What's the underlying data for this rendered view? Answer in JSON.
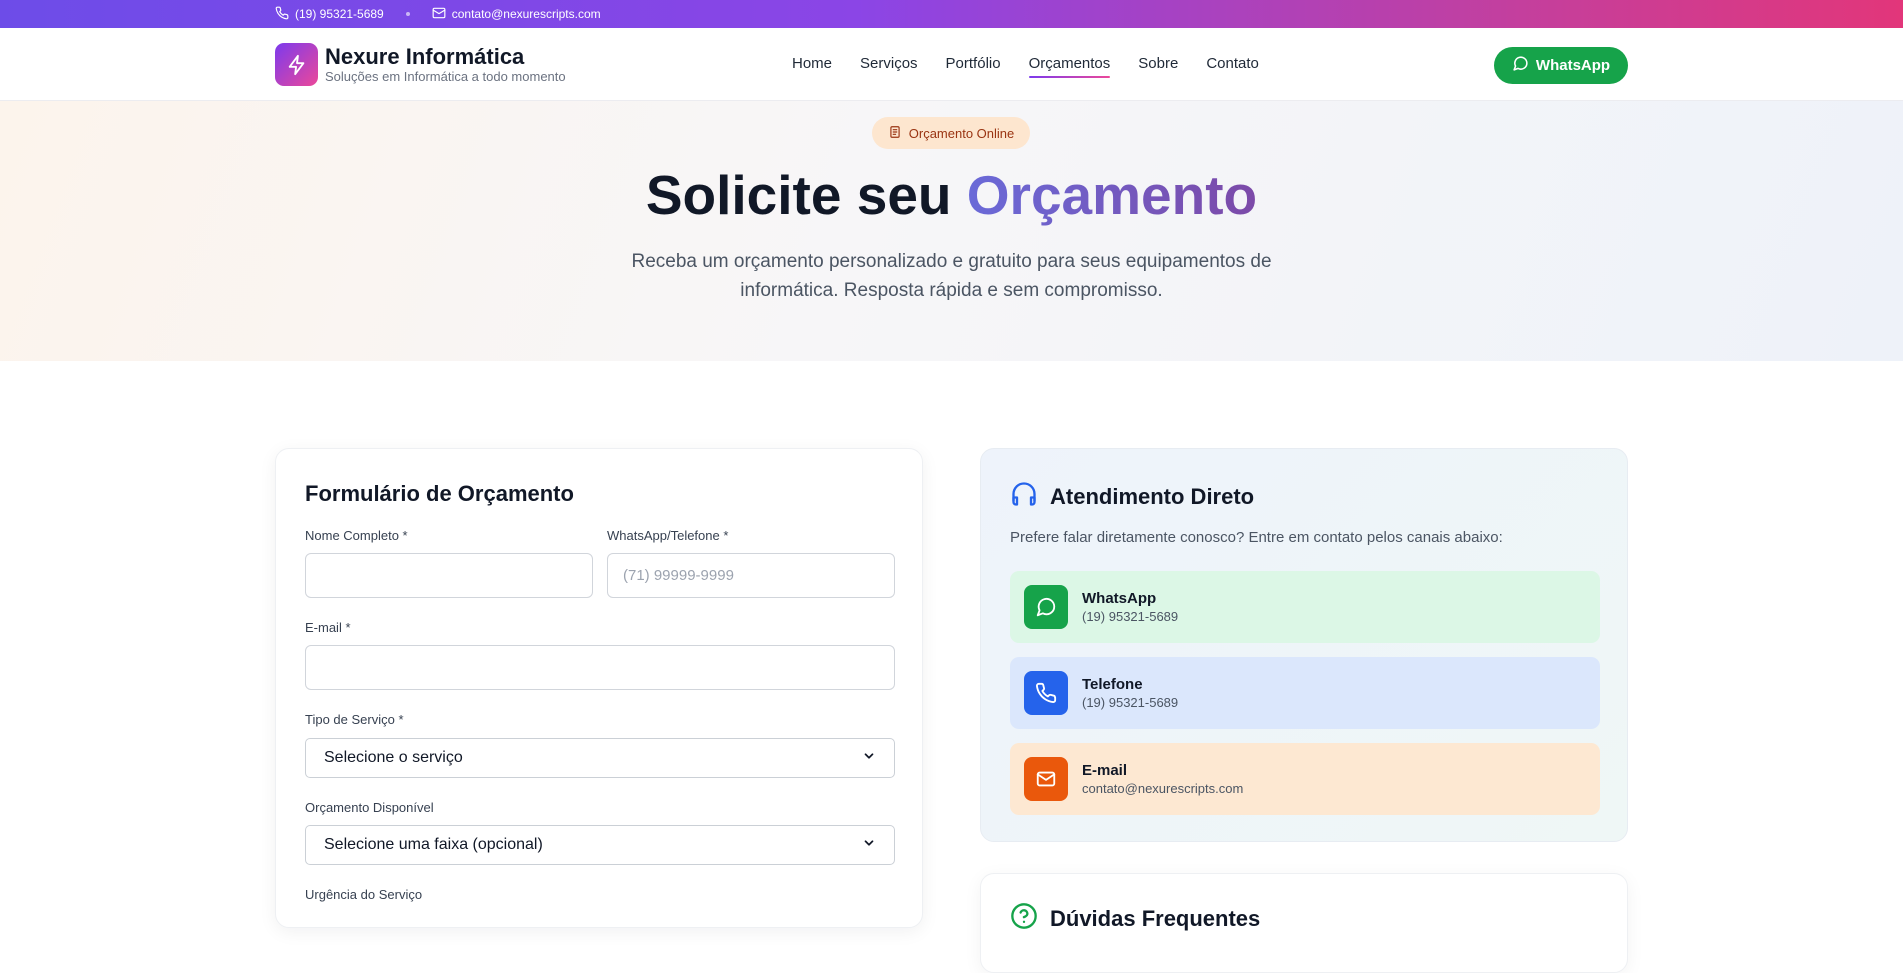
{
  "topbar": {
    "phone": "(19) 95321-5689",
    "email": "contato@nexurescripts.com"
  },
  "brand": {
    "name": "Nexure Informática",
    "tagline": "Soluções em Informática a todo momento"
  },
  "nav": {
    "items": [
      {
        "label": "Home",
        "active": false
      },
      {
        "label": "Serviços",
        "active": false
      },
      {
        "label": "Portfólio",
        "active": false
      },
      {
        "label": "Orçamentos",
        "active": true
      },
      {
        "label": "Sobre",
        "active": false
      },
      {
        "label": "Contato",
        "active": false
      }
    ],
    "cta_label": "WhatsApp"
  },
  "hero": {
    "badge": "Orçamento Online",
    "title_part1": "Solicite seu ",
    "title_part2": "Orçamento",
    "description": "Receba um orçamento personalizado e gratuito para seus equipamentos de informática. Resposta rápida e sem compromisso."
  },
  "form": {
    "title": "Formulário de Orçamento",
    "name_label": "Nome Completo *",
    "name_value": "",
    "phone_label": "WhatsApp/Telefone *",
    "phone_placeholder": "(71) 99999-9999",
    "email_label": "E-mail *",
    "email_value": "",
    "service_label": "Tipo de Serviço *",
    "service_selected": "Selecione o serviço",
    "budget_label": "Orçamento Disponível",
    "budget_selected": "Selecione uma faixa (opcional)",
    "urgency_label": "Urgência do Serviço"
  },
  "direct": {
    "title": "Atendimento Direto",
    "text": "Prefere falar diretamente conosco? Entre em contato pelos canais abaixo:",
    "contacts": [
      {
        "name": "WhatsApp",
        "value": "(19) 95321-5689",
        "icon": "whatsapp-icon",
        "bg": "#dcf7e6",
        "icon_bg": "#16a34a"
      },
      {
        "name": "Telefone",
        "value": "(19) 95321-5689",
        "icon": "phone-icon",
        "bg": "#dbe7fc",
        "icon_bg": "#2563eb"
      },
      {
        "name": "E-mail",
        "value": "contato@nexurescripts.com",
        "icon": "mail-icon",
        "bg": "#fde8d2",
        "icon_bg": "#ea580c"
      }
    ]
  },
  "faq": {
    "title": "Dúvidas Frequentes"
  },
  "colors": {
    "accent_purple": "#7c3aed",
    "accent_pink": "#ec4899",
    "whatsapp_green": "#16a34a"
  }
}
